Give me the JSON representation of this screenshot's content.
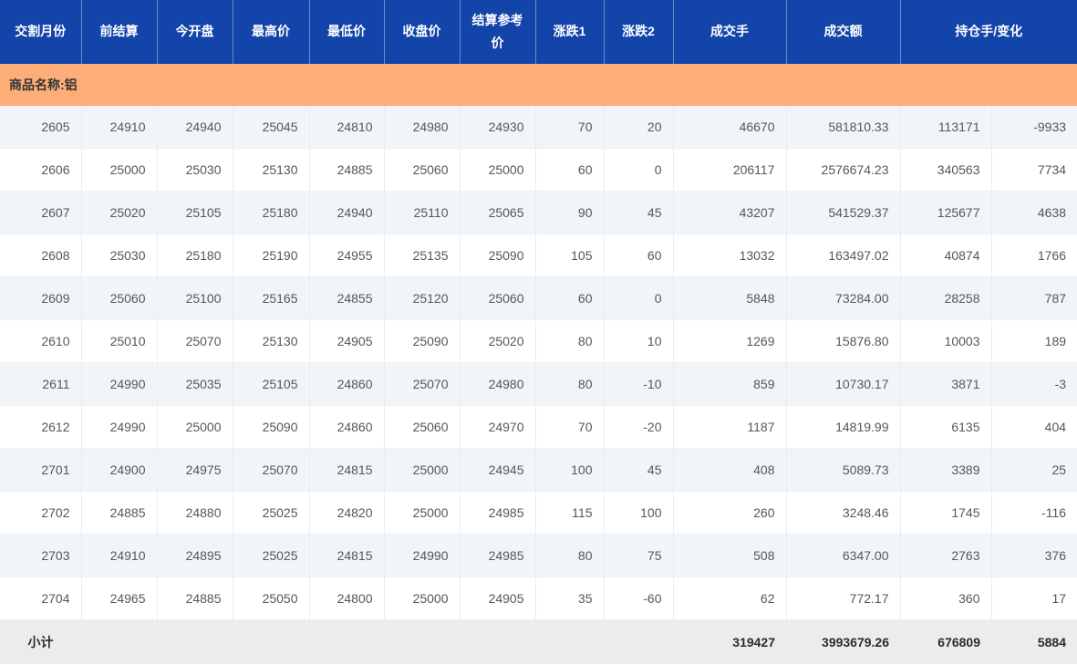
{
  "table": {
    "headers": [
      {
        "key": "month",
        "label": "交割月份"
      },
      {
        "key": "prev_settle",
        "label": "前结算"
      },
      {
        "key": "open",
        "label": "今开盘"
      },
      {
        "key": "high",
        "label": "最高价"
      },
      {
        "key": "low",
        "label": "最低价"
      },
      {
        "key": "close",
        "label": "收盘价"
      },
      {
        "key": "settle_ref",
        "label": "结算参考价"
      },
      {
        "key": "change1",
        "label": "涨跌1"
      },
      {
        "key": "change2",
        "label": "涨跌2"
      },
      {
        "key": "volume",
        "label": "成交手"
      },
      {
        "key": "turnover",
        "label": "成交额"
      },
      {
        "key": "oi_and_change",
        "label": "持仓手/变化"
      }
    ],
    "group_label": "商品名称:铝",
    "rows": [
      [
        "2605",
        "24910",
        "24940",
        "25045",
        "24810",
        "24980",
        "24930",
        "70",
        "20",
        "46670",
        "581810.33",
        "113171",
        "-9933"
      ],
      [
        "2606",
        "25000",
        "25030",
        "25130",
        "24885",
        "25060",
        "25000",
        "60",
        "0",
        "206117",
        "2576674.23",
        "340563",
        "7734"
      ],
      [
        "2607",
        "25020",
        "25105",
        "25180",
        "24940",
        "25110",
        "25065",
        "90",
        "45",
        "43207",
        "541529.37",
        "125677",
        "4638"
      ],
      [
        "2608",
        "25030",
        "25180",
        "25190",
        "24955",
        "25135",
        "25090",
        "105",
        "60",
        "13032",
        "163497.02",
        "40874",
        "1766"
      ],
      [
        "2609",
        "25060",
        "25100",
        "25165",
        "24855",
        "25120",
        "25060",
        "60",
        "0",
        "5848",
        "73284.00",
        "28258",
        "787"
      ],
      [
        "2610",
        "25010",
        "25070",
        "25130",
        "24905",
        "25090",
        "25020",
        "80",
        "10",
        "1269",
        "15876.80",
        "10003",
        "189"
      ],
      [
        "2611",
        "24990",
        "25035",
        "25105",
        "24860",
        "25070",
        "24980",
        "80",
        "-10",
        "859",
        "10730.17",
        "3871",
        "-3"
      ],
      [
        "2612",
        "24990",
        "25000",
        "25090",
        "24860",
        "25060",
        "24970",
        "70",
        "-20",
        "1187",
        "14819.99",
        "6135",
        "404"
      ],
      [
        "2701",
        "24900",
        "24975",
        "25070",
        "24815",
        "25000",
        "24945",
        "100",
        "45",
        "408",
        "5089.73",
        "3389",
        "25"
      ],
      [
        "2702",
        "24885",
        "24880",
        "25025",
        "24820",
        "25000",
        "24985",
        "115",
        "100",
        "260",
        "3248.46",
        "1745",
        "-116"
      ],
      [
        "2703",
        "24910",
        "24895",
        "25025",
        "24815",
        "24990",
        "24985",
        "80",
        "75",
        "508",
        "6347.00",
        "2763",
        "376"
      ],
      [
        "2704",
        "24965",
        "24885",
        "25050",
        "24800",
        "25000",
        "24905",
        "35",
        "-60",
        "62",
        "772.17",
        "360",
        "17"
      ]
    ],
    "footer": {
      "label": "小计",
      "values": [
        "",
        "",
        "",
        "",
        "",
        "",
        "",
        "",
        "319427",
        "3993679.26",
        "676809",
        "5884"
      ]
    }
  },
  "colors": {
    "header_bg": "#1244A9",
    "group_bg": "#FDAD77",
    "row_alt_bg": "#F1F4F9",
    "footer_bg": "#ECECEE"
  }
}
